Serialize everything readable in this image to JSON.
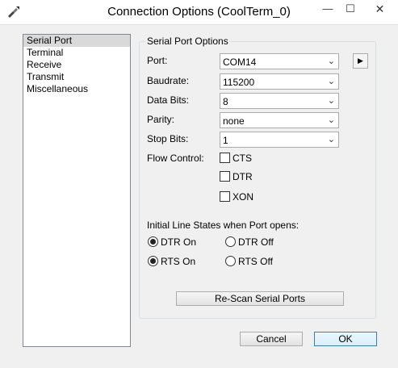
{
  "window": {
    "title": "Connection Options (CoolTerm_0)",
    "minimize_glyph": "—",
    "maximize_glyph": "☐",
    "close_glyph": "✕"
  },
  "nav": {
    "items": [
      {
        "label": "Serial Port",
        "selected": true
      },
      {
        "label": "Terminal",
        "selected": false
      },
      {
        "label": "Receive",
        "selected": false
      },
      {
        "label": "Transmit",
        "selected": false
      },
      {
        "label": "Miscellaneous",
        "selected": false
      }
    ]
  },
  "serial": {
    "group_title": "Serial Port Options",
    "port_label": "Port:",
    "port_value": "COM14",
    "baud_label": "Baudrate:",
    "baud_value": "115200",
    "databits_label": "Data Bits:",
    "databits_value": "8",
    "parity_label": "Parity:",
    "parity_value": "none",
    "stopbits_label": "Stop Bits:",
    "stopbits_value": "1",
    "flow_label": "Flow Control:",
    "flow": [
      {
        "label": "CTS",
        "checked": false
      },
      {
        "label": "DTR",
        "checked": false
      },
      {
        "label": "XON",
        "checked": false
      }
    ],
    "initial_states_label": "Initial Line States when Port opens:",
    "dtr_on": "DTR On",
    "dtr_off": "DTR Off",
    "rts_on": "RTS On",
    "rts_off": "RTS Off",
    "rescan_label": "Re-Scan Serial Ports"
  },
  "footer": {
    "cancel_label": "Cancel",
    "ok_label": "OK"
  },
  "icons": {
    "dropdown_arrow": "⌄",
    "side_arrow": "▶"
  }
}
